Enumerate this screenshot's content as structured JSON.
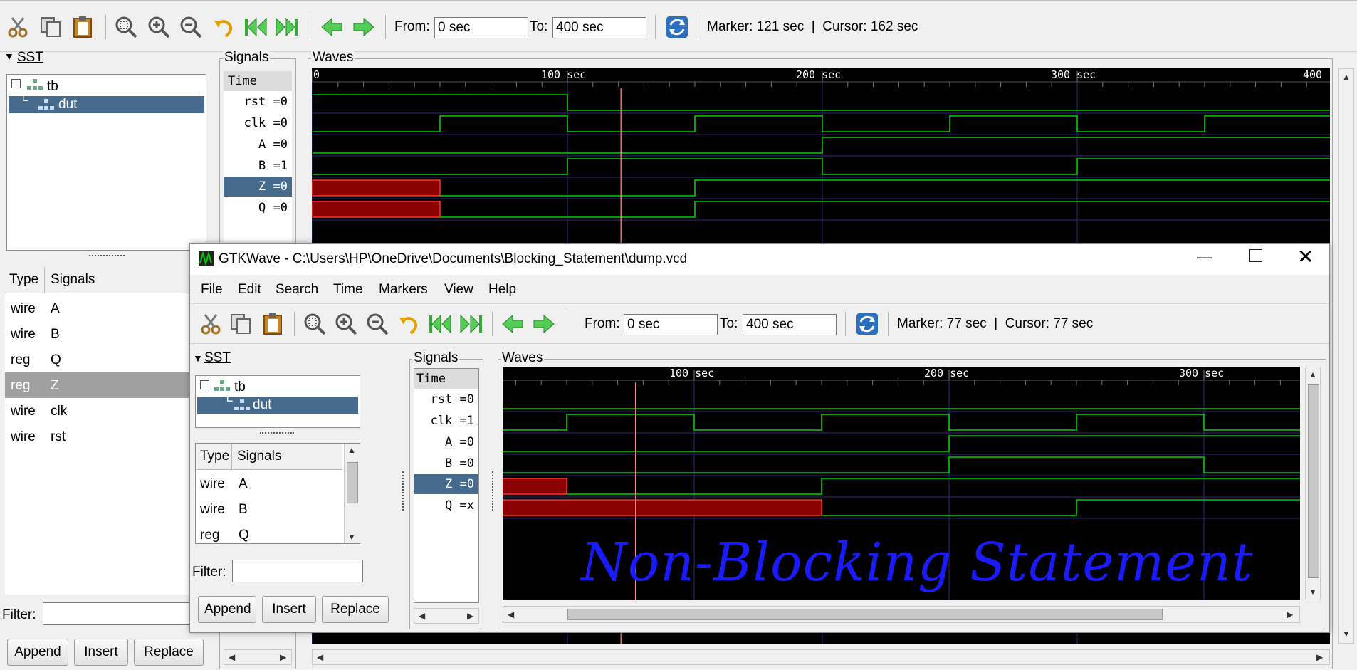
{
  "back": {
    "toolbar": {
      "from_label": "From:",
      "from_value": "0 sec",
      "to_label": "To:",
      "to_value": "400 sec",
      "status": "Marker: 121 sec  |  Cursor: 162 sec"
    },
    "sst_title": "SST",
    "tree": [
      "tb",
      "dut"
    ],
    "signals_title": "Signals",
    "waves_title": "Waves",
    "time_header": "Time",
    "signals": [
      "rst =0",
      "clk =0",
      "A =0",
      "B =1",
      "Z =0",
      "Q =0"
    ],
    "type_header": "Type",
    "signals_header": "Signals",
    "decls": [
      {
        "type": "wire",
        "name": "A"
      },
      {
        "type": "wire",
        "name": "B"
      },
      {
        "type": "reg",
        "name": "Q"
      },
      {
        "type": "reg",
        "name": "Z"
      },
      {
        "type": "wire",
        "name": "clk"
      },
      {
        "type": "wire",
        "name": "rst"
      }
    ],
    "filter_label": "Filter:",
    "buttons": {
      "append": "Append",
      "insert": "Insert",
      "replace": "Replace"
    },
    "ticks": [
      "0",
      "100 sec",
      "200 sec",
      "300 sec",
      "400"
    ],
    "wave_color": "#00d000",
    "undefined_color": "#8b0000",
    "marker_color": "#ff7f7f"
  },
  "front": {
    "title": "GTKWave - C:\\Users\\HP\\OneDrive\\Documents\\Blocking_Statement\\dump.vcd",
    "menu": [
      "File",
      "Edit",
      "Search",
      "Time",
      "Markers",
      "View",
      "Help"
    ],
    "toolbar": {
      "from_label": "From:",
      "from_value": "0 sec",
      "to_label": "To:",
      "to_value": "400 sec",
      "status": "Marker: 77 sec  |  Cursor: 77 sec"
    },
    "sst_title": "SST",
    "tree": [
      "tb",
      "dut"
    ],
    "signals_title": "Signals",
    "waves_title": "Waves",
    "time_header": "Time",
    "signals": [
      "rst =0",
      "clk =1",
      "A =0",
      "B =0",
      "Z =0",
      "Q =x"
    ],
    "type_header": "Type",
    "signals_header": "Signals",
    "decls": [
      {
        "type": "wire",
        "name": "A"
      },
      {
        "type": "wire",
        "name": "B"
      },
      {
        "type": "reg",
        "name": "Q"
      }
    ],
    "filter_label": "Filter:",
    "buttons": {
      "append": "Append",
      "insert": "Insert",
      "replace": "Replace"
    },
    "ticks": [
      "100 sec",
      "200 sec",
      "300 sec"
    ],
    "annotation": "Non-Blocking Statement",
    "annotation_color": "#1a1aff"
  }
}
